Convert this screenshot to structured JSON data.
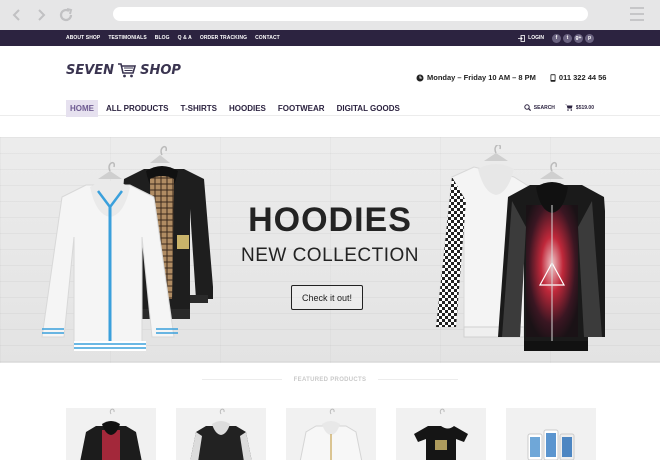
{
  "topbar": {
    "links": [
      "ABOUT SHOP",
      "TESTIMONIALS",
      "BLOG",
      "Q & A",
      "ORDER TRACKING",
      "CONTACT"
    ],
    "login": "LOGIN",
    "social": [
      "f",
      "t",
      "g+",
      "p"
    ]
  },
  "header": {
    "logo_left": "SEVEN",
    "logo_right": "SHOP",
    "hours": "Monday – Friday 10 AM – 8 PM",
    "phone": "011 322 44 56"
  },
  "nav": {
    "items": [
      "HOME",
      "ALL PRODUCTS",
      "T-SHIRTS",
      "HOODIES",
      "FOOTWEAR",
      "DIGITAL GOODS"
    ],
    "search": "SEARCH",
    "cart_total": "$519.00"
  },
  "hero": {
    "title": "HOODIES",
    "subtitle": "NEW COLLECTION",
    "button": "Check it out!"
  },
  "featured": {
    "heading": "FEATURED PRODUCTS"
  },
  "colors": {
    "topbar": "#2c2340",
    "accent": "#6d5a91",
    "hero_bg": "#e7e7e7"
  }
}
